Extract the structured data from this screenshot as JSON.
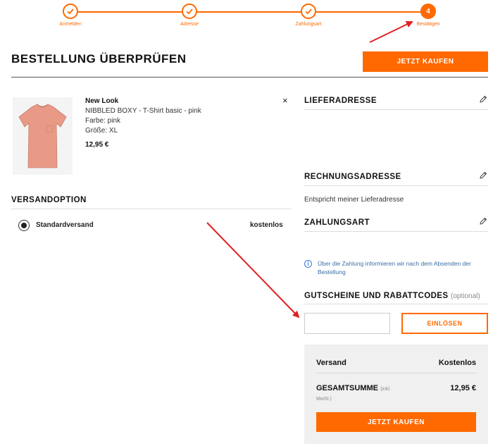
{
  "stepper": {
    "steps": [
      {
        "label": "Anmelden",
        "state": "done"
      },
      {
        "label": "Adresse",
        "state": "done"
      },
      {
        "label": "Zahlungsart",
        "state": "done"
      },
      {
        "label": "Bestätigen",
        "state": "current",
        "number": "4"
      }
    ]
  },
  "header": {
    "title": "BESTELLUNG ÜBERPRÜFEN",
    "buy_label": "JETZT KAUFEN"
  },
  "product": {
    "brand": "New Look",
    "name": "NIBBLED BOXY - T-Shirt basic - pink",
    "color": "Farbe: pink",
    "size": "Größe: XL",
    "price": "12,95 €",
    "remove": "×"
  },
  "shipping": {
    "title": "VERSANDOPTION",
    "option_label": "Standardversand",
    "option_price": "kostenlos"
  },
  "delivery": {
    "title": "LIEFERADRESSE"
  },
  "billing": {
    "title": "RECHNUNGSADRESSE",
    "text": "Entspricht meiner Lieferadresse"
  },
  "payment": {
    "title": "ZAHLUNGSART",
    "info_icon": "i",
    "info_text": "Über die Zahlung informieren wir nach dem Absenden der Bestellung"
  },
  "voucher": {
    "title": "GUTSCHEINE UND RABATTCODES",
    "optional": "(optional)",
    "input_value": "",
    "redeem_label": "EINLÖSEN"
  },
  "summary": {
    "shipping_label": "Versand",
    "shipping_value": "Kostenlos",
    "total_label": "GESAMTSUMME",
    "total_note": "(inkl.",
    "total_note2": "MwSt.)",
    "total_value": "12,95 €",
    "buy_label": "JETZT KAUFEN"
  },
  "colors": {
    "accent": "#ff6900",
    "info": "#3a7bd5",
    "annotation": "#e02020"
  }
}
